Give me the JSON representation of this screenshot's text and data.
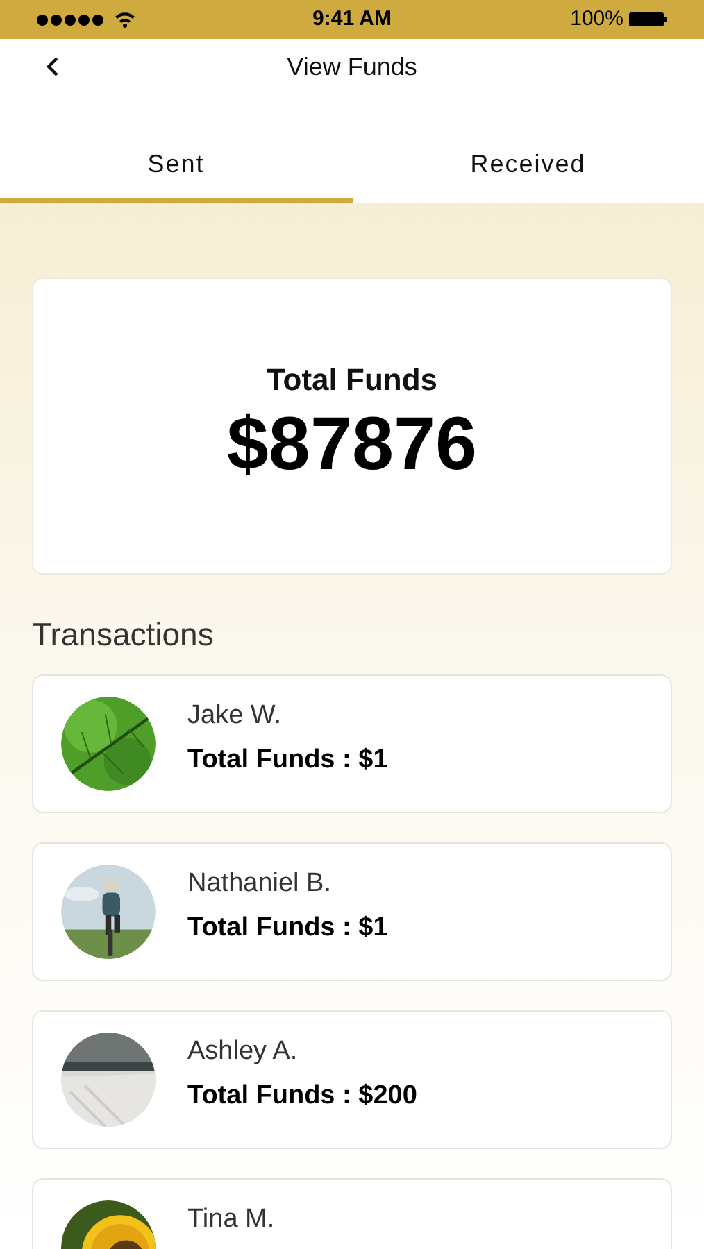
{
  "status_bar": {
    "time": "9:41 AM",
    "battery": "100%"
  },
  "header": {
    "title": "View Funds"
  },
  "tabs": [
    {
      "label": "Sent",
      "selected": true
    },
    {
      "label": "Received",
      "selected": false
    }
  ],
  "summary": {
    "label": "Total Funds",
    "amount": "$87876"
  },
  "transactions": {
    "heading": "Transactions",
    "items": [
      {
        "name": "Jake W.",
        "total": "Total Funds : $1",
        "avatar": {
          "kind": "leaf"
        }
      },
      {
        "name": "Nathaniel B.",
        "total": "Total Funds : $1",
        "avatar": {
          "kind": "cyclist"
        }
      },
      {
        "name": "Ashley A.",
        "total": "Total Funds : $200",
        "avatar": {
          "kind": "room"
        }
      },
      {
        "name": "Tina M.",
        "avatar": {
          "kind": "flower"
        }
      }
    ]
  }
}
